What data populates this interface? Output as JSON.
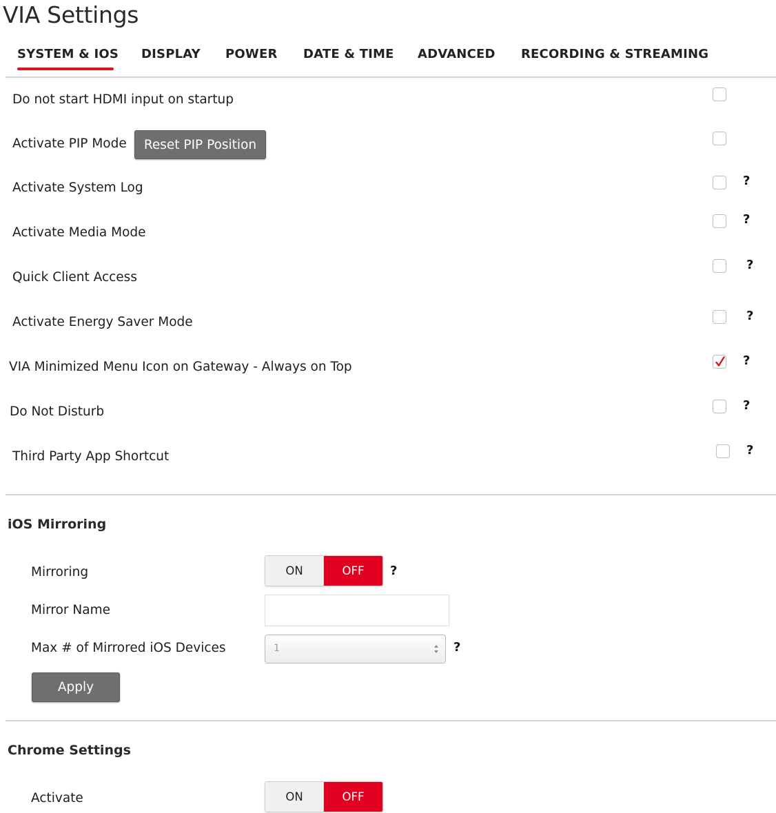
{
  "page": {
    "title": "VIA Settings"
  },
  "tabs": [
    {
      "label": "SYSTEM & IOS",
      "active": true
    },
    {
      "label": "DISPLAY",
      "active": false
    },
    {
      "label": "POWER",
      "active": false
    },
    {
      "label": "DATE & TIME",
      "active": false
    },
    {
      "label": "ADVANCED",
      "active": false
    },
    {
      "label": "RECORDING & STREAMING",
      "active": false
    }
  ],
  "system": {
    "rows": [
      {
        "label": "Do not start HDMI input on startup",
        "checked": false,
        "help": false
      },
      {
        "label": "Activate PIP Mode",
        "checked": false,
        "help": false,
        "button": "Reset PIP Position"
      },
      {
        "label": "Activate System Log",
        "checked": false,
        "help": true
      },
      {
        "label": "Activate Media Mode",
        "checked": false,
        "help": true
      },
      {
        "label": "Quick Client Access",
        "checked": false,
        "help": true
      },
      {
        "label": "Activate Energy Saver Mode",
        "checked": false,
        "help": true
      },
      {
        "label": "VIA Minimized Menu Icon on Gateway - Always on Top",
        "checked": true,
        "help": true
      },
      {
        "label": "Do Not Disturb",
        "checked": false,
        "help": true
      },
      {
        "label": "Third Party App Shortcut",
        "checked": false,
        "help": true
      }
    ],
    "help_glyph": "?"
  },
  "ios": {
    "title": "iOS Mirroring",
    "mirroring_label": "Mirroring",
    "toggle_on": "ON",
    "toggle_off": "OFF",
    "mirroring_state": "OFF",
    "mirror_name_label": "Mirror Name",
    "mirror_name_value": "",
    "max_devices_label": "Max # of Mirrored iOS Devices",
    "max_devices_value": "1",
    "apply_label": "Apply"
  },
  "chrome": {
    "title": "Chrome Settings",
    "activate_label": "Activate",
    "toggle_on": "ON",
    "toggle_off": "OFF",
    "state": "OFF"
  },
  "colors": {
    "accent": "#e1001f",
    "underline": "#d7191f",
    "button": "#6f6f6f"
  }
}
